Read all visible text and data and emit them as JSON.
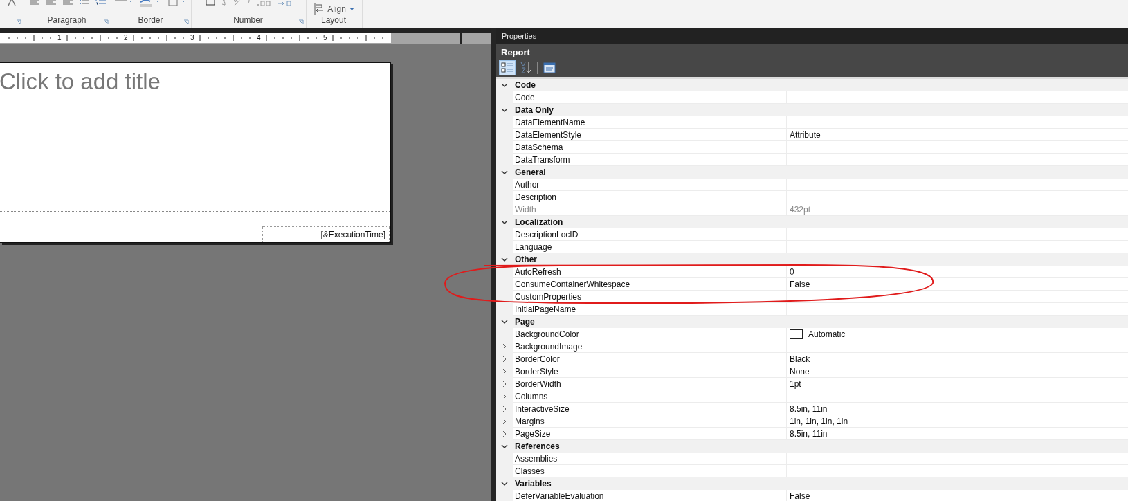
{
  "ribbon": {
    "groups": [
      {
        "label": "Paragraph",
        "kind": "paragraph"
      },
      {
        "label": "Border",
        "kind": "border"
      },
      {
        "label": "Number",
        "kind": "number"
      },
      {
        "label": "Layout",
        "kind": "layout",
        "button": "Align"
      }
    ]
  },
  "ruler": {
    "labels": [
      "1",
      "2",
      "3",
      "4",
      "5"
    ]
  },
  "report": {
    "title_placeholder": "Click to add title",
    "footer_field": "[&ExecutionTime]"
  },
  "properties": {
    "title": "Properties",
    "object": "Report",
    "toolbar": [
      {
        "kind": "categorized",
        "selected": true
      },
      {
        "kind": "alphabetical",
        "selected": false
      },
      {
        "kind": "pages",
        "selected": false
      }
    ],
    "categories": [
      {
        "name": "Code",
        "expanded": true,
        "items": [
          {
            "name": "Code",
            "value": "",
            "expandable": false,
            "disabled": false
          }
        ]
      },
      {
        "name": "Data Only",
        "expanded": true,
        "items": [
          {
            "name": "DataElementName",
            "value": "",
            "expandable": false,
            "disabled": false
          },
          {
            "name": "DataElementStyle",
            "value": "Attribute",
            "expandable": false,
            "disabled": false
          },
          {
            "name": "DataSchema",
            "value": "",
            "expandable": false,
            "disabled": false
          },
          {
            "name": "DataTransform",
            "value": "",
            "expandable": false,
            "disabled": false
          }
        ]
      },
      {
        "name": "General",
        "expanded": true,
        "items": [
          {
            "name": "Author",
            "value": "",
            "expandable": false,
            "disabled": false
          },
          {
            "name": "Description",
            "value": "",
            "expandable": false,
            "disabled": false
          },
          {
            "name": "Width",
            "value": "432pt",
            "expandable": false,
            "disabled": true
          }
        ]
      },
      {
        "name": "Localization",
        "expanded": true,
        "items": [
          {
            "name": "DescriptionLocID",
            "value": "",
            "expandable": false,
            "disabled": false
          },
          {
            "name": "Language",
            "value": "",
            "expandable": false,
            "disabled": false
          }
        ]
      },
      {
        "name": "Other",
        "expanded": true,
        "items": [
          {
            "name": "AutoRefresh",
            "value": "0",
            "expandable": false,
            "disabled": false
          },
          {
            "name": "ConsumeContainerWhitespace",
            "value": "False",
            "expandable": false,
            "disabled": false
          },
          {
            "name": "CustomProperties",
            "value": "",
            "expandable": false,
            "disabled": false
          },
          {
            "name": "InitialPageName",
            "value": "",
            "expandable": false,
            "disabled": false
          }
        ]
      },
      {
        "name": "Page",
        "expanded": true,
        "items": [
          {
            "name": "BackgroundColor",
            "value": "Automatic",
            "expandable": false,
            "disabled": false,
            "swatch": true
          },
          {
            "name": "BackgroundImage",
            "value": "",
            "expandable": true,
            "disabled": false
          },
          {
            "name": "BorderColor",
            "value": "Black",
            "expandable": true,
            "disabled": false
          },
          {
            "name": "BorderStyle",
            "value": "None",
            "expandable": true,
            "disabled": false
          },
          {
            "name": "BorderWidth",
            "value": "1pt",
            "expandable": true,
            "disabled": false
          },
          {
            "name": "Columns",
            "value": "",
            "expandable": true,
            "disabled": false
          },
          {
            "name": "InteractiveSize",
            "value": "8.5in, 11in",
            "expandable": true,
            "disabled": false
          },
          {
            "name": "Margins",
            "value": "1in, 1in, 1in, 1in",
            "expandable": true,
            "disabled": false
          },
          {
            "name": "PageSize",
            "value": "8.5in, 11in",
            "expandable": true,
            "disabled": false
          }
        ]
      },
      {
        "name": "References",
        "expanded": true,
        "items": [
          {
            "name": "Assemblies",
            "value": "",
            "expandable": false,
            "disabled": false
          },
          {
            "name": "Classes",
            "value": "",
            "expandable": false,
            "disabled": false
          }
        ]
      },
      {
        "name": "Variables",
        "expanded": true,
        "items": [
          {
            "name": "DeferVariableEvaluation",
            "value": "False",
            "expandable": false,
            "disabled": false
          }
        ]
      }
    ]
  }
}
